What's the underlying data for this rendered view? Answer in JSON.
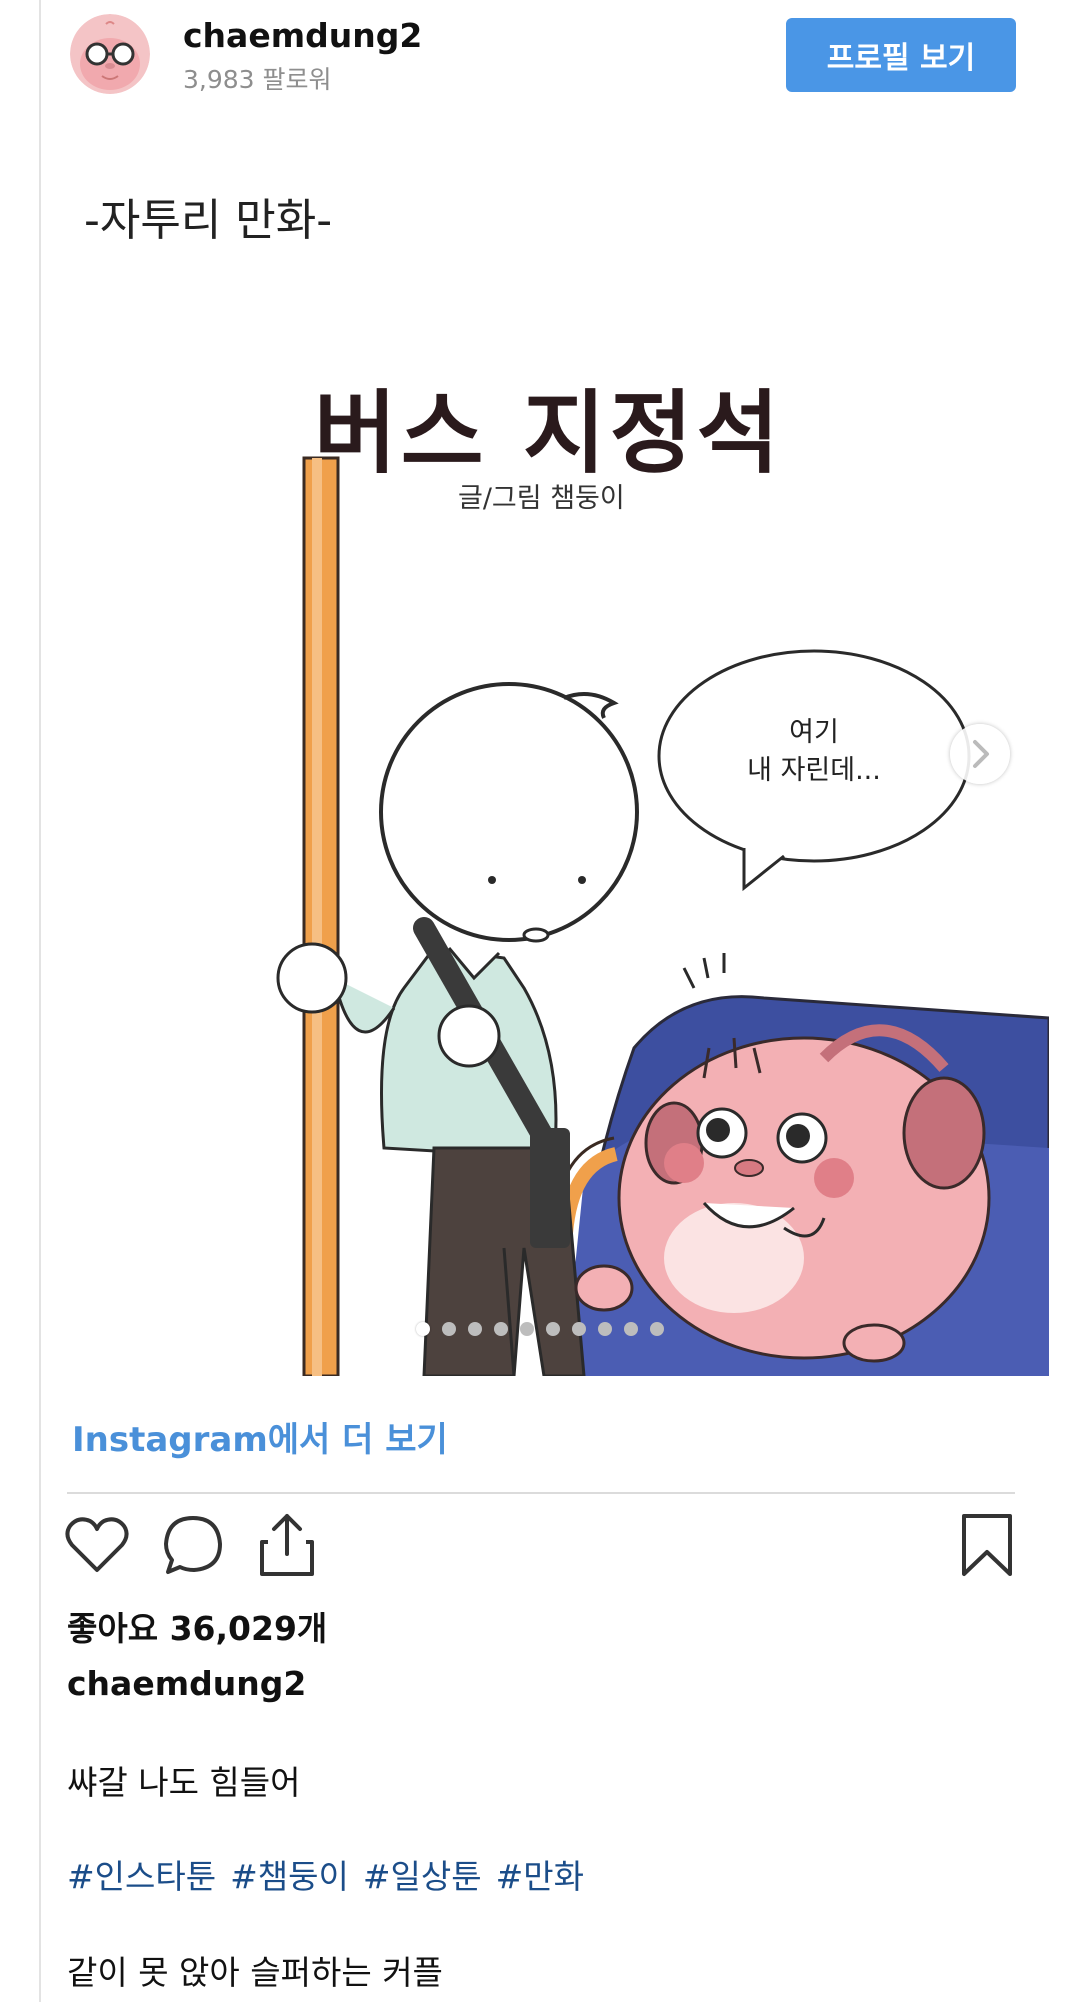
{
  "header": {
    "username": "chaemdung2",
    "followers": "3,983 팔로워",
    "profile_button": "프로필 보기"
  },
  "post": {
    "comic_subtitle": "-자투리 만화-",
    "comic_title": "버스 지정석",
    "comic_credit": "글/그림 챔둥이",
    "speech_bubble": [
      "여기",
      "내 자린데..."
    ],
    "carousel": {
      "slide_count": 10,
      "active_index": 0
    }
  },
  "more_link": "Instagram에서 더 보기",
  "likes": "좋아요 36,029개",
  "caption": {
    "username": "chaemdung2",
    "text": "쌰갈 나도 힘들어",
    "hashtags": [
      "#인스타툰",
      "#챔둥이",
      "#일상툰",
      "#만화"
    ],
    "text2": "같이 못 앉아 슬퍼하는 커플"
  },
  "icons": [
    "heart-icon",
    "comment-icon",
    "share-icon",
    "bookmark-icon",
    "chevron-right-icon"
  ],
  "colors": {
    "primary_button": "#4a96e6",
    "link": "#4a90d9",
    "hashtag": "#1b4d89",
    "pole": "#f0a04b",
    "seat": "#3d4fa0",
    "character_pink": "#f3b0b4"
  }
}
